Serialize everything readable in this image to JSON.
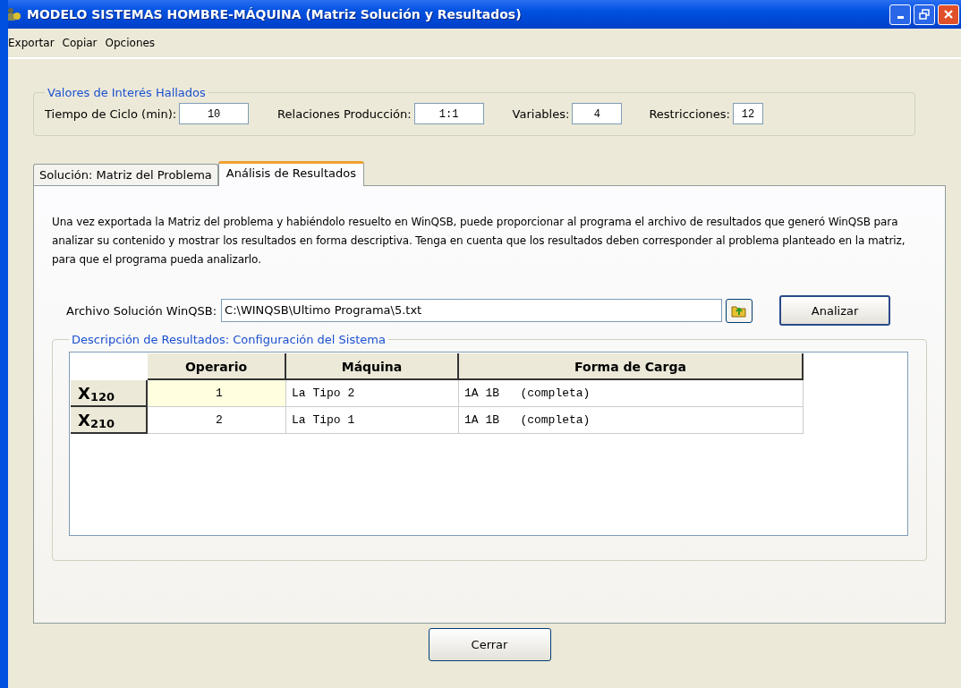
{
  "window": {
    "title": "MODELO SISTEMAS HOMBRE-MÁQUINA (Matriz Solución y Resultados)"
  },
  "menu": [
    "Exportar",
    "Copiar",
    "Opciones"
  ],
  "values_group": {
    "legend": "Valores de Interés Hallados",
    "fields": [
      {
        "label": "Tiempo de Ciclo (min):",
        "value": "10"
      },
      {
        "label": "Relaciones Producción:",
        "value": "1:1"
      },
      {
        "label": "Variables:",
        "value": "4"
      },
      {
        "label": "Restricciones:",
        "value": "12"
      }
    ]
  },
  "tabs": [
    {
      "label": "Solución: Matriz del Problema",
      "selected": false
    },
    {
      "label": "Análisis de Resultados",
      "selected": true
    }
  ],
  "description": "Una vez exportada la Matriz del problema y habiéndolo resuelto en WinQSB, puede proporcionar al programa el archivo de resultados que generó WinQSB para analizar su contenido y mostrar los resultados en forma descriptiva. Tenga en cuenta que los resultados deben corresponder al problema planteado en la matriz, para que el programa pueda analizarlo.",
  "file": {
    "label": "Archivo Solución WinQSB:",
    "value": "C:\\WINQSB\\Ultimo Programa\\5.txt",
    "button": "Analizar"
  },
  "results_group": {
    "legend": "Descripción de Resultados: Configuración del Sistema",
    "table": {
      "columns": [
        "Operario",
        "Máquina",
        "Forma de Carga"
      ],
      "rows": [
        {
          "label": "X$_{120}$",
          "cells": [
            {
              "text": "1",
              "selected": true
            },
            {
              "text": "La Tipo 2",
              "selected": false
            },
            {
              "text": "1A 1B   (completa)",
              "selected": false
            }
          ]
        },
        {
          "label": "X$_{210}$",
          "cells": [
            {
              "text": "2",
              "selected": false
            },
            {
              "text": "La Tipo 1",
              "selected": false
            },
            {
              "text": "1A 1B   (completa)",
              "selected": false
            }
          ]
        }
      ]
    }
  },
  "close_button": "Cerrar"
}
